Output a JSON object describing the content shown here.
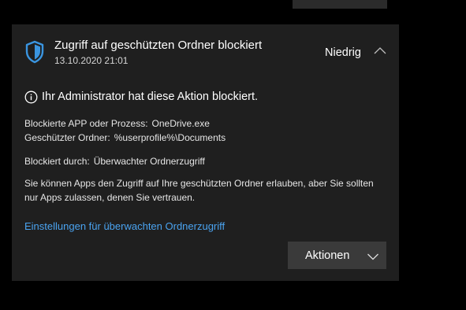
{
  "notification": {
    "title": "Zugriff auf geschützten Ordner blockiert",
    "date": "13.10.2020 21:01",
    "severity": "Niedrig",
    "info_text": "Ihr Administrator hat diese Aktion blockiert.",
    "blocked_app_label": "Blockierte APP oder Prozess:",
    "blocked_app_value": "OneDrive.exe",
    "protected_folder_label": "Geschützter Ordner:",
    "protected_folder_value": "%userprofile%\\Documents",
    "blocked_by_label": "Blockiert durch:",
    "blocked_by_value": "Überwachter Ordnerzugriff",
    "description": "Sie können Apps den Zugriff auf Ihre geschützten Ordner erlauben, aber Sie sollten nur Apps zulassen, denen Sie vertrauen.",
    "settings_link": "Einstellungen für überwachten Ordnerzugriff",
    "actions_label": "Aktionen"
  },
  "icons": {
    "shield": "shield-icon",
    "collapse": "chevron-up-icon",
    "info": "info-icon",
    "dropdown": "chevron-down-icon"
  },
  "colors": {
    "background": "#000000",
    "card": "#1f1f1f",
    "accent": "#4aa3f0",
    "shield": "#3a95e0",
    "button": "#3a3a3a"
  }
}
